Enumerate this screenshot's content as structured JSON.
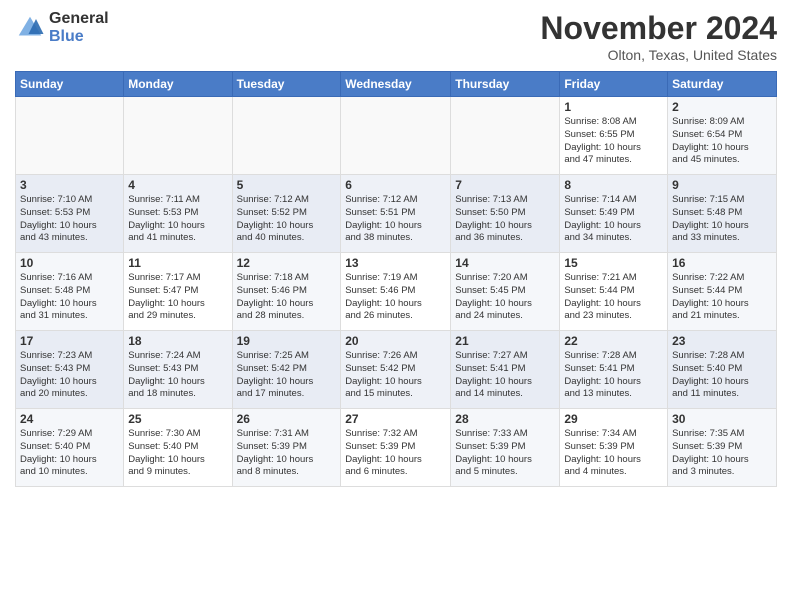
{
  "header": {
    "logo_line1": "General",
    "logo_line2": "Blue",
    "month_title": "November 2024",
    "location": "Olton, Texas, United States"
  },
  "days_of_week": [
    "Sunday",
    "Monday",
    "Tuesday",
    "Wednesday",
    "Thursday",
    "Friday",
    "Saturday"
  ],
  "weeks": [
    [
      {
        "day": "",
        "info": ""
      },
      {
        "day": "",
        "info": ""
      },
      {
        "day": "",
        "info": ""
      },
      {
        "day": "",
        "info": ""
      },
      {
        "day": "",
        "info": ""
      },
      {
        "day": "1",
        "info": "Sunrise: 8:08 AM\nSunset: 6:55 PM\nDaylight: 10 hours\nand 47 minutes."
      },
      {
        "day": "2",
        "info": "Sunrise: 8:09 AM\nSunset: 6:54 PM\nDaylight: 10 hours\nand 45 minutes."
      }
    ],
    [
      {
        "day": "3",
        "info": "Sunrise: 7:10 AM\nSunset: 5:53 PM\nDaylight: 10 hours\nand 43 minutes."
      },
      {
        "day": "4",
        "info": "Sunrise: 7:11 AM\nSunset: 5:53 PM\nDaylight: 10 hours\nand 41 minutes."
      },
      {
        "day": "5",
        "info": "Sunrise: 7:12 AM\nSunset: 5:52 PM\nDaylight: 10 hours\nand 40 minutes."
      },
      {
        "day": "6",
        "info": "Sunrise: 7:12 AM\nSunset: 5:51 PM\nDaylight: 10 hours\nand 38 minutes."
      },
      {
        "day": "7",
        "info": "Sunrise: 7:13 AM\nSunset: 5:50 PM\nDaylight: 10 hours\nand 36 minutes."
      },
      {
        "day": "8",
        "info": "Sunrise: 7:14 AM\nSunset: 5:49 PM\nDaylight: 10 hours\nand 34 minutes."
      },
      {
        "day": "9",
        "info": "Sunrise: 7:15 AM\nSunset: 5:48 PM\nDaylight: 10 hours\nand 33 minutes."
      }
    ],
    [
      {
        "day": "10",
        "info": "Sunrise: 7:16 AM\nSunset: 5:48 PM\nDaylight: 10 hours\nand 31 minutes."
      },
      {
        "day": "11",
        "info": "Sunrise: 7:17 AM\nSunset: 5:47 PM\nDaylight: 10 hours\nand 29 minutes."
      },
      {
        "day": "12",
        "info": "Sunrise: 7:18 AM\nSunset: 5:46 PM\nDaylight: 10 hours\nand 28 minutes."
      },
      {
        "day": "13",
        "info": "Sunrise: 7:19 AM\nSunset: 5:46 PM\nDaylight: 10 hours\nand 26 minutes."
      },
      {
        "day": "14",
        "info": "Sunrise: 7:20 AM\nSunset: 5:45 PM\nDaylight: 10 hours\nand 24 minutes."
      },
      {
        "day": "15",
        "info": "Sunrise: 7:21 AM\nSunset: 5:44 PM\nDaylight: 10 hours\nand 23 minutes."
      },
      {
        "day": "16",
        "info": "Sunrise: 7:22 AM\nSunset: 5:44 PM\nDaylight: 10 hours\nand 21 minutes."
      }
    ],
    [
      {
        "day": "17",
        "info": "Sunrise: 7:23 AM\nSunset: 5:43 PM\nDaylight: 10 hours\nand 20 minutes."
      },
      {
        "day": "18",
        "info": "Sunrise: 7:24 AM\nSunset: 5:43 PM\nDaylight: 10 hours\nand 18 minutes."
      },
      {
        "day": "19",
        "info": "Sunrise: 7:25 AM\nSunset: 5:42 PM\nDaylight: 10 hours\nand 17 minutes."
      },
      {
        "day": "20",
        "info": "Sunrise: 7:26 AM\nSunset: 5:42 PM\nDaylight: 10 hours\nand 15 minutes."
      },
      {
        "day": "21",
        "info": "Sunrise: 7:27 AM\nSunset: 5:41 PM\nDaylight: 10 hours\nand 14 minutes."
      },
      {
        "day": "22",
        "info": "Sunrise: 7:28 AM\nSunset: 5:41 PM\nDaylight: 10 hours\nand 13 minutes."
      },
      {
        "day": "23",
        "info": "Sunrise: 7:28 AM\nSunset: 5:40 PM\nDaylight: 10 hours\nand 11 minutes."
      }
    ],
    [
      {
        "day": "24",
        "info": "Sunrise: 7:29 AM\nSunset: 5:40 PM\nDaylight: 10 hours\nand 10 minutes."
      },
      {
        "day": "25",
        "info": "Sunrise: 7:30 AM\nSunset: 5:40 PM\nDaylight: 10 hours\nand 9 minutes."
      },
      {
        "day": "26",
        "info": "Sunrise: 7:31 AM\nSunset: 5:39 PM\nDaylight: 10 hours\nand 8 minutes."
      },
      {
        "day": "27",
        "info": "Sunrise: 7:32 AM\nSunset: 5:39 PM\nDaylight: 10 hours\nand 6 minutes."
      },
      {
        "day": "28",
        "info": "Sunrise: 7:33 AM\nSunset: 5:39 PM\nDaylight: 10 hours\nand 5 minutes."
      },
      {
        "day": "29",
        "info": "Sunrise: 7:34 AM\nSunset: 5:39 PM\nDaylight: 10 hours\nand 4 minutes."
      },
      {
        "day": "30",
        "info": "Sunrise: 7:35 AM\nSunset: 5:39 PM\nDaylight: 10 hours\nand 3 minutes."
      }
    ]
  ]
}
